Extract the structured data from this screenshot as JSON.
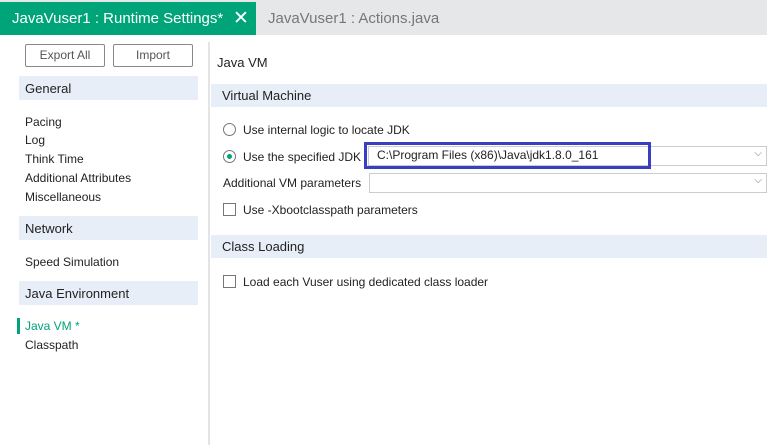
{
  "tabs": [
    {
      "label": "JavaVuser1 : Runtime Settings*",
      "active": true
    },
    {
      "label": "JavaVuser1 : Actions.java",
      "active": false
    }
  ],
  "accent": "#00a479",
  "toolbar": {
    "export_all": "Export All",
    "import": "Import"
  },
  "sidebar": {
    "sections": [
      {
        "title": "General",
        "items": [
          "Pacing",
          "Log",
          "Think Time",
          "Additional Attributes",
          "Miscellaneous"
        ]
      },
      {
        "title": "Network",
        "items": [
          "Speed Simulation"
        ]
      },
      {
        "title": "Java Environment",
        "items": [
          "Java VM *",
          "Classpath"
        ]
      }
    ],
    "selected": "Java VM *"
  },
  "main": {
    "title": "Java VM",
    "virtual_machine": {
      "header": "Virtual Machine",
      "radio_internal": "Use internal logic to locate JDK",
      "radio_specified": "Use the specified JDK",
      "selected_radio": "specified",
      "jdk_path": "C:\\Program Files (x86)\\Java\\jdk1.8.0_161",
      "additional_vm_label": "Additional VM parameters",
      "additional_vm_value": "",
      "xboot_label": "Use -Xbootclasspath parameters",
      "xboot_checked": false
    },
    "class_loading": {
      "header": "Class Loading",
      "dedicated_label": "Load each Vuser using dedicated class loader",
      "dedicated_checked": false
    }
  }
}
